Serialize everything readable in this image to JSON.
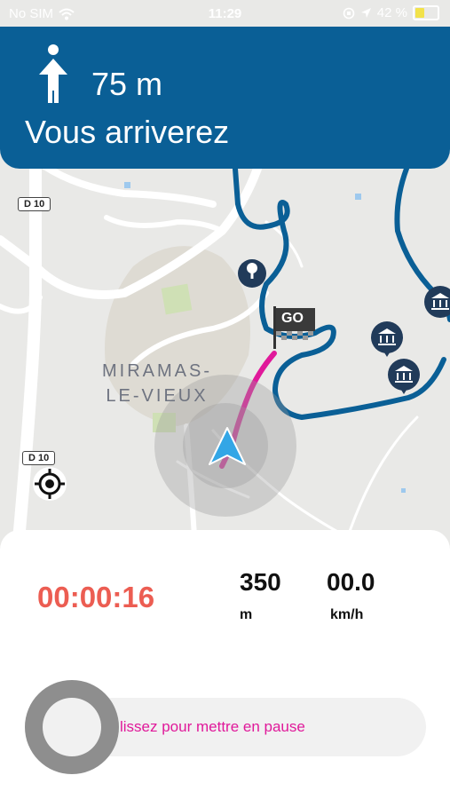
{
  "status_bar": {
    "carrier": "No SIM",
    "time": "11:29",
    "battery": "42 %"
  },
  "navigation": {
    "distance": "75 m",
    "instruction": "Vous arriverez",
    "maneuver_icon": "straight-arrow-icon"
  },
  "map": {
    "place_label_line1": "MIRAMAS-",
    "place_label_line2": "LE-VIEUX",
    "road_badge_top": "D 10",
    "road_badge_bottom": "D 10",
    "go_label": "GO",
    "colors": {
      "route": "#0a5f96",
      "active_path": "#e0199a",
      "banner": "#0a5f96"
    }
  },
  "stats": {
    "elapsed_time": "00:00:16",
    "distance_value": "350",
    "distance_unit": "m",
    "speed_value": "00.0",
    "speed_unit": "km/h"
  },
  "pause_slider": {
    "label": "lissez pour mettre en pause"
  }
}
